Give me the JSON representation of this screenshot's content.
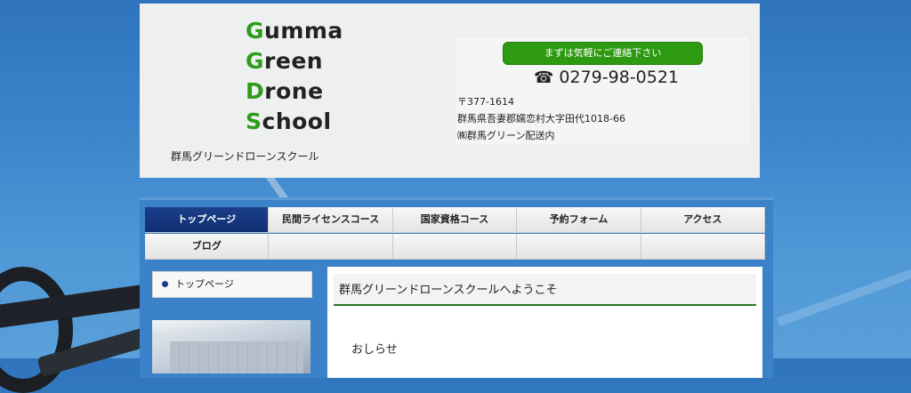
{
  "header": {
    "logo_lines": [
      {
        "first": "G",
        "rest": "umma"
      },
      {
        "first": "G",
        "rest": "reen"
      },
      {
        "first": "D",
        "rest": "rone"
      },
      {
        "first": "S",
        "rest": "chool"
      }
    ],
    "site_subtitle": "群馬グリーンドローンスクール",
    "contact_button": "まずは気軽にご連絡下さい",
    "phone_icon": "telephone-icon",
    "phone_glyph": "☎",
    "phone": "0279-98-0521",
    "postal": "〒377-1614",
    "address": "群馬県吾妻郡嬬恋村大字田代1018-66",
    "company": "㈱群馬グリーン配送内"
  },
  "nav": {
    "row1": [
      "トップページ",
      "民間ライセンスコース",
      "国家資格コース",
      "予約フォーム",
      "アクセス"
    ],
    "row2": [
      "ブログ",
      "",
      "",
      "",
      ""
    ]
  },
  "sidebar": {
    "items": [
      "トップページ"
    ]
  },
  "main": {
    "welcome_title": "群馬グリーンドローンスクールへようこそ",
    "news_heading": "おしらせ"
  },
  "colors": {
    "brand_green": "#2d9c1b",
    "nav_active": "#0f2f73",
    "button_green": "#2e9a12",
    "frame_blue": "#3c82c8"
  }
}
